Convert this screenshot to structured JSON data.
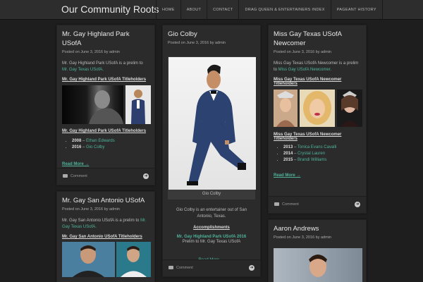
{
  "site": {
    "title": "Our Community Roots"
  },
  "nav": [
    "HOME",
    "ABOUT",
    "CONTACT",
    "DRAG QUEEN & ENTERTAINERS INDEX",
    "PAGEANT HISTORY"
  ],
  "cards": {
    "c1": {
      "title": "Mr. Gay Highland Park USofA",
      "meta_prefix": "Posted on June 3, 2016 by ",
      "meta_author": "admin",
      "intro": "Mr. Gay Highland Park USofA is a prelim to ",
      "intro_link": "Mr. Gay Texas USofA.",
      "heading1": "Mr. Gay Highland Park USofA Titleholders",
      "heading2": "Mr. Gay Highland Park USofA Titleholders",
      "list": [
        {
          "year": "2008",
          "name": "Ethan Edwards"
        },
        {
          "year": "2016",
          "name": "Gio Colby"
        }
      ],
      "read_more": "Read More →",
      "comment": "Comment"
    },
    "c2": {
      "title": "Mr. Gay San Antonio USofA",
      "meta_prefix": "Posted on June 3, 2016 by ",
      "meta_author": "admin",
      "intro": "Mr. Gay San Antonio USofA is a prelim to ",
      "intro_link": "Mr. Gay Texas USofA.",
      "heading1": "Mr. Gay San Antonio USofA Titleholders"
    },
    "c3": {
      "title": "Gio Colby",
      "meta_prefix": "Posted on June 3, 2016 by ",
      "meta_author": "admin",
      "caption": "Gio Colby",
      "body": "Gio Colby is an entertainer out of San Antonio, Texas.",
      "heading": "Accomplishments",
      "acc_title": "Mr. Gay Highland Park USofA 2016",
      "acc_sub": "Prelim to Mr. Gay Texas USofA",
      "read_more": "Read More →",
      "comment": "Comment"
    },
    "c4": {
      "title": "Miss Gay Texas USofA Newcomer",
      "meta_prefix": "Posted on June 3, 2016 by ",
      "meta_author": "admin",
      "intro": "Miss Gay Texas USofA Newcomer is a prelim to ",
      "intro_link": "Miss Gay USofA Newcomer.",
      "heading1": "Miss Gay Texas USofA Newcomer Titleholders",
      "heading2": "Miss Gay Texas USofA Newcomer Titleholders",
      "list": [
        {
          "year": "2013",
          "name": "Tonica Evans Cavalli"
        },
        {
          "year": "2014",
          "name": "Crystal Lauren"
        },
        {
          "year": "2015",
          "name": "Brandi Williams"
        }
      ],
      "read_more": "Read More →",
      "comment": "Comment"
    },
    "c5": {
      "title": "Aaron Andrews",
      "meta_prefix": "Posted on June 3, 2016 by ",
      "meta_author": "admin"
    }
  },
  "colors": {
    "accent": "#4fb39a",
    "background": "#1e1e1e",
    "card": "#2b2b2b"
  },
  "icons": {
    "comment": "comment-icon",
    "arrow": "arrow-right-icon"
  }
}
